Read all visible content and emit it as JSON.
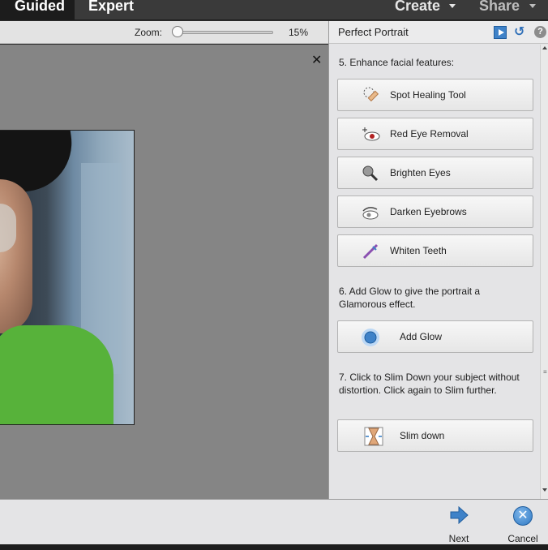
{
  "top_bar": {
    "mode_tabs": [
      {
        "label": "Guided",
        "active": true
      },
      {
        "label": "Expert",
        "active": false
      }
    ],
    "create_label": "Create",
    "share_label": "Share"
  },
  "zoom": {
    "label": "Zoom:",
    "value": "15%"
  },
  "panel": {
    "title": "Perfect Portrait",
    "header_icons": [
      "play-icon",
      "reset-icon",
      "help-icon"
    ],
    "help_glyph": "?",
    "section5": "5. Enhance facial features:",
    "tools5": [
      {
        "label": "Spot Healing Tool",
        "icon": "spot-healing-icon"
      },
      {
        "label": "Red Eye Removal",
        "icon": "red-eye-icon"
      },
      {
        "label": "Brighten Eyes",
        "icon": "brighten-eyes-icon"
      },
      {
        "label": "Darken Eyebrows",
        "icon": "darken-eyebrows-icon"
      },
      {
        "label": "Whiten Teeth",
        "icon": "whiten-teeth-icon"
      }
    ],
    "section6": "6. Add Glow to give the portrait a Glamorous effect.",
    "add_glow_label": "Add Glow",
    "section7": "7. Click to Slim Down your subject without distortion. Click again to Slim further.",
    "slim_down_label": "Slim down"
  },
  "bottom": {
    "next_label": "Next",
    "cancel_label": "Cancel"
  },
  "colors": {
    "accent": "#3f82c8",
    "canvas": "#858585",
    "panel": "#e4e4e6"
  }
}
